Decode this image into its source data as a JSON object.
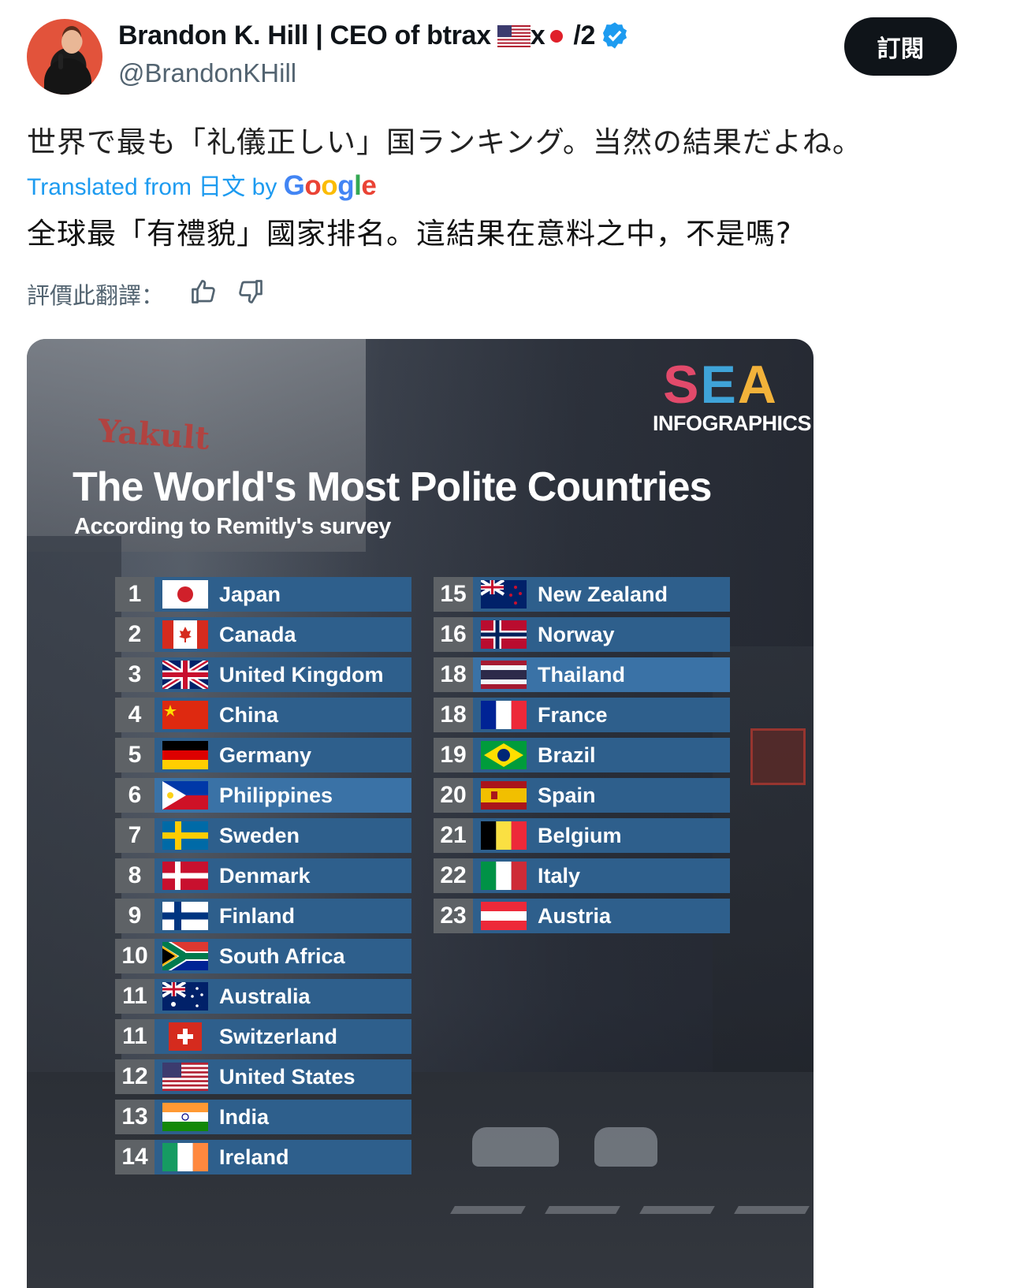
{
  "author": {
    "name": "Brandon K. Hill | CEO of btrax",
    "name_suffix_x": "x",
    "name_suffix_2": "/2",
    "handle": "@BrandonKHill"
  },
  "subscribe_label": "訂閱",
  "tweet": {
    "original_text": "世界で最も「礼儀正しい」国ランキング。当然の結果だよね。",
    "translated_from": "Translated from 日文 by",
    "google": [
      "G",
      "o",
      "o",
      "g",
      "l",
      "e"
    ],
    "translated_text": "全球最「有禮貌」國家排名。這結果在意料之中，不是嗎?",
    "rate_label": "評價此翻譯："
  },
  "infographic": {
    "logo_sea": [
      "S",
      "E",
      "A"
    ],
    "logo_sub": "INFOGRAPHICS",
    "bg_sign": "Yakult",
    "title": "The World's Most Polite Countries",
    "subtitle": "According to Remitly's survey",
    "left_ranks": [
      {
        "rank": "1",
        "country": "Japan",
        "flag": "jp"
      },
      {
        "rank": "2",
        "country": "Canada",
        "flag": "ca"
      },
      {
        "rank": "3",
        "country": "United Kingdom",
        "flag": "gb"
      },
      {
        "rank": "4",
        "country": "China",
        "flag": "cn"
      },
      {
        "rank": "5",
        "country": "Germany",
        "flag": "de"
      },
      {
        "rank": "6",
        "country": "Philippines",
        "flag": "ph"
      },
      {
        "rank": "7",
        "country": "Sweden",
        "flag": "se"
      },
      {
        "rank": "8",
        "country": "Denmark",
        "flag": "dk"
      },
      {
        "rank": "9",
        "country": "Finland",
        "flag": "fi"
      },
      {
        "rank": "10",
        "country": "South Africa",
        "flag": "za"
      },
      {
        "rank": "11",
        "country": "Australia",
        "flag": "au"
      },
      {
        "rank": "11",
        "country": "Switzerland",
        "flag": "ch"
      },
      {
        "rank": "12",
        "country": "United States",
        "flag": "us"
      },
      {
        "rank": "13",
        "country": "India",
        "flag": "in"
      },
      {
        "rank": "14",
        "country": "Ireland",
        "flag": "ie"
      }
    ],
    "right_ranks": [
      {
        "rank": "15",
        "country": "New Zealand",
        "flag": "nz"
      },
      {
        "rank": "16",
        "country": "Norway",
        "flag": "no"
      },
      {
        "rank": "18",
        "country": "Thailand",
        "flag": "th"
      },
      {
        "rank": "18",
        "country": "France",
        "flag": "fr"
      },
      {
        "rank": "19",
        "country": "Brazil",
        "flag": "br"
      },
      {
        "rank": "20",
        "country": "Spain",
        "flag": "es"
      },
      {
        "rank": "21",
        "country": "Belgium",
        "flag": "be"
      },
      {
        "rank": "22",
        "country": "Italy",
        "flag": "it"
      },
      {
        "rank": "23",
        "country": "Austria",
        "flag": "at"
      }
    ]
  },
  "colors": {
    "accent_link": "#1d9bf0",
    "row_blue": "#2e5f8c",
    "row_highlight": "#3a72a6",
    "rank_badge": "#5e6266"
  }
}
